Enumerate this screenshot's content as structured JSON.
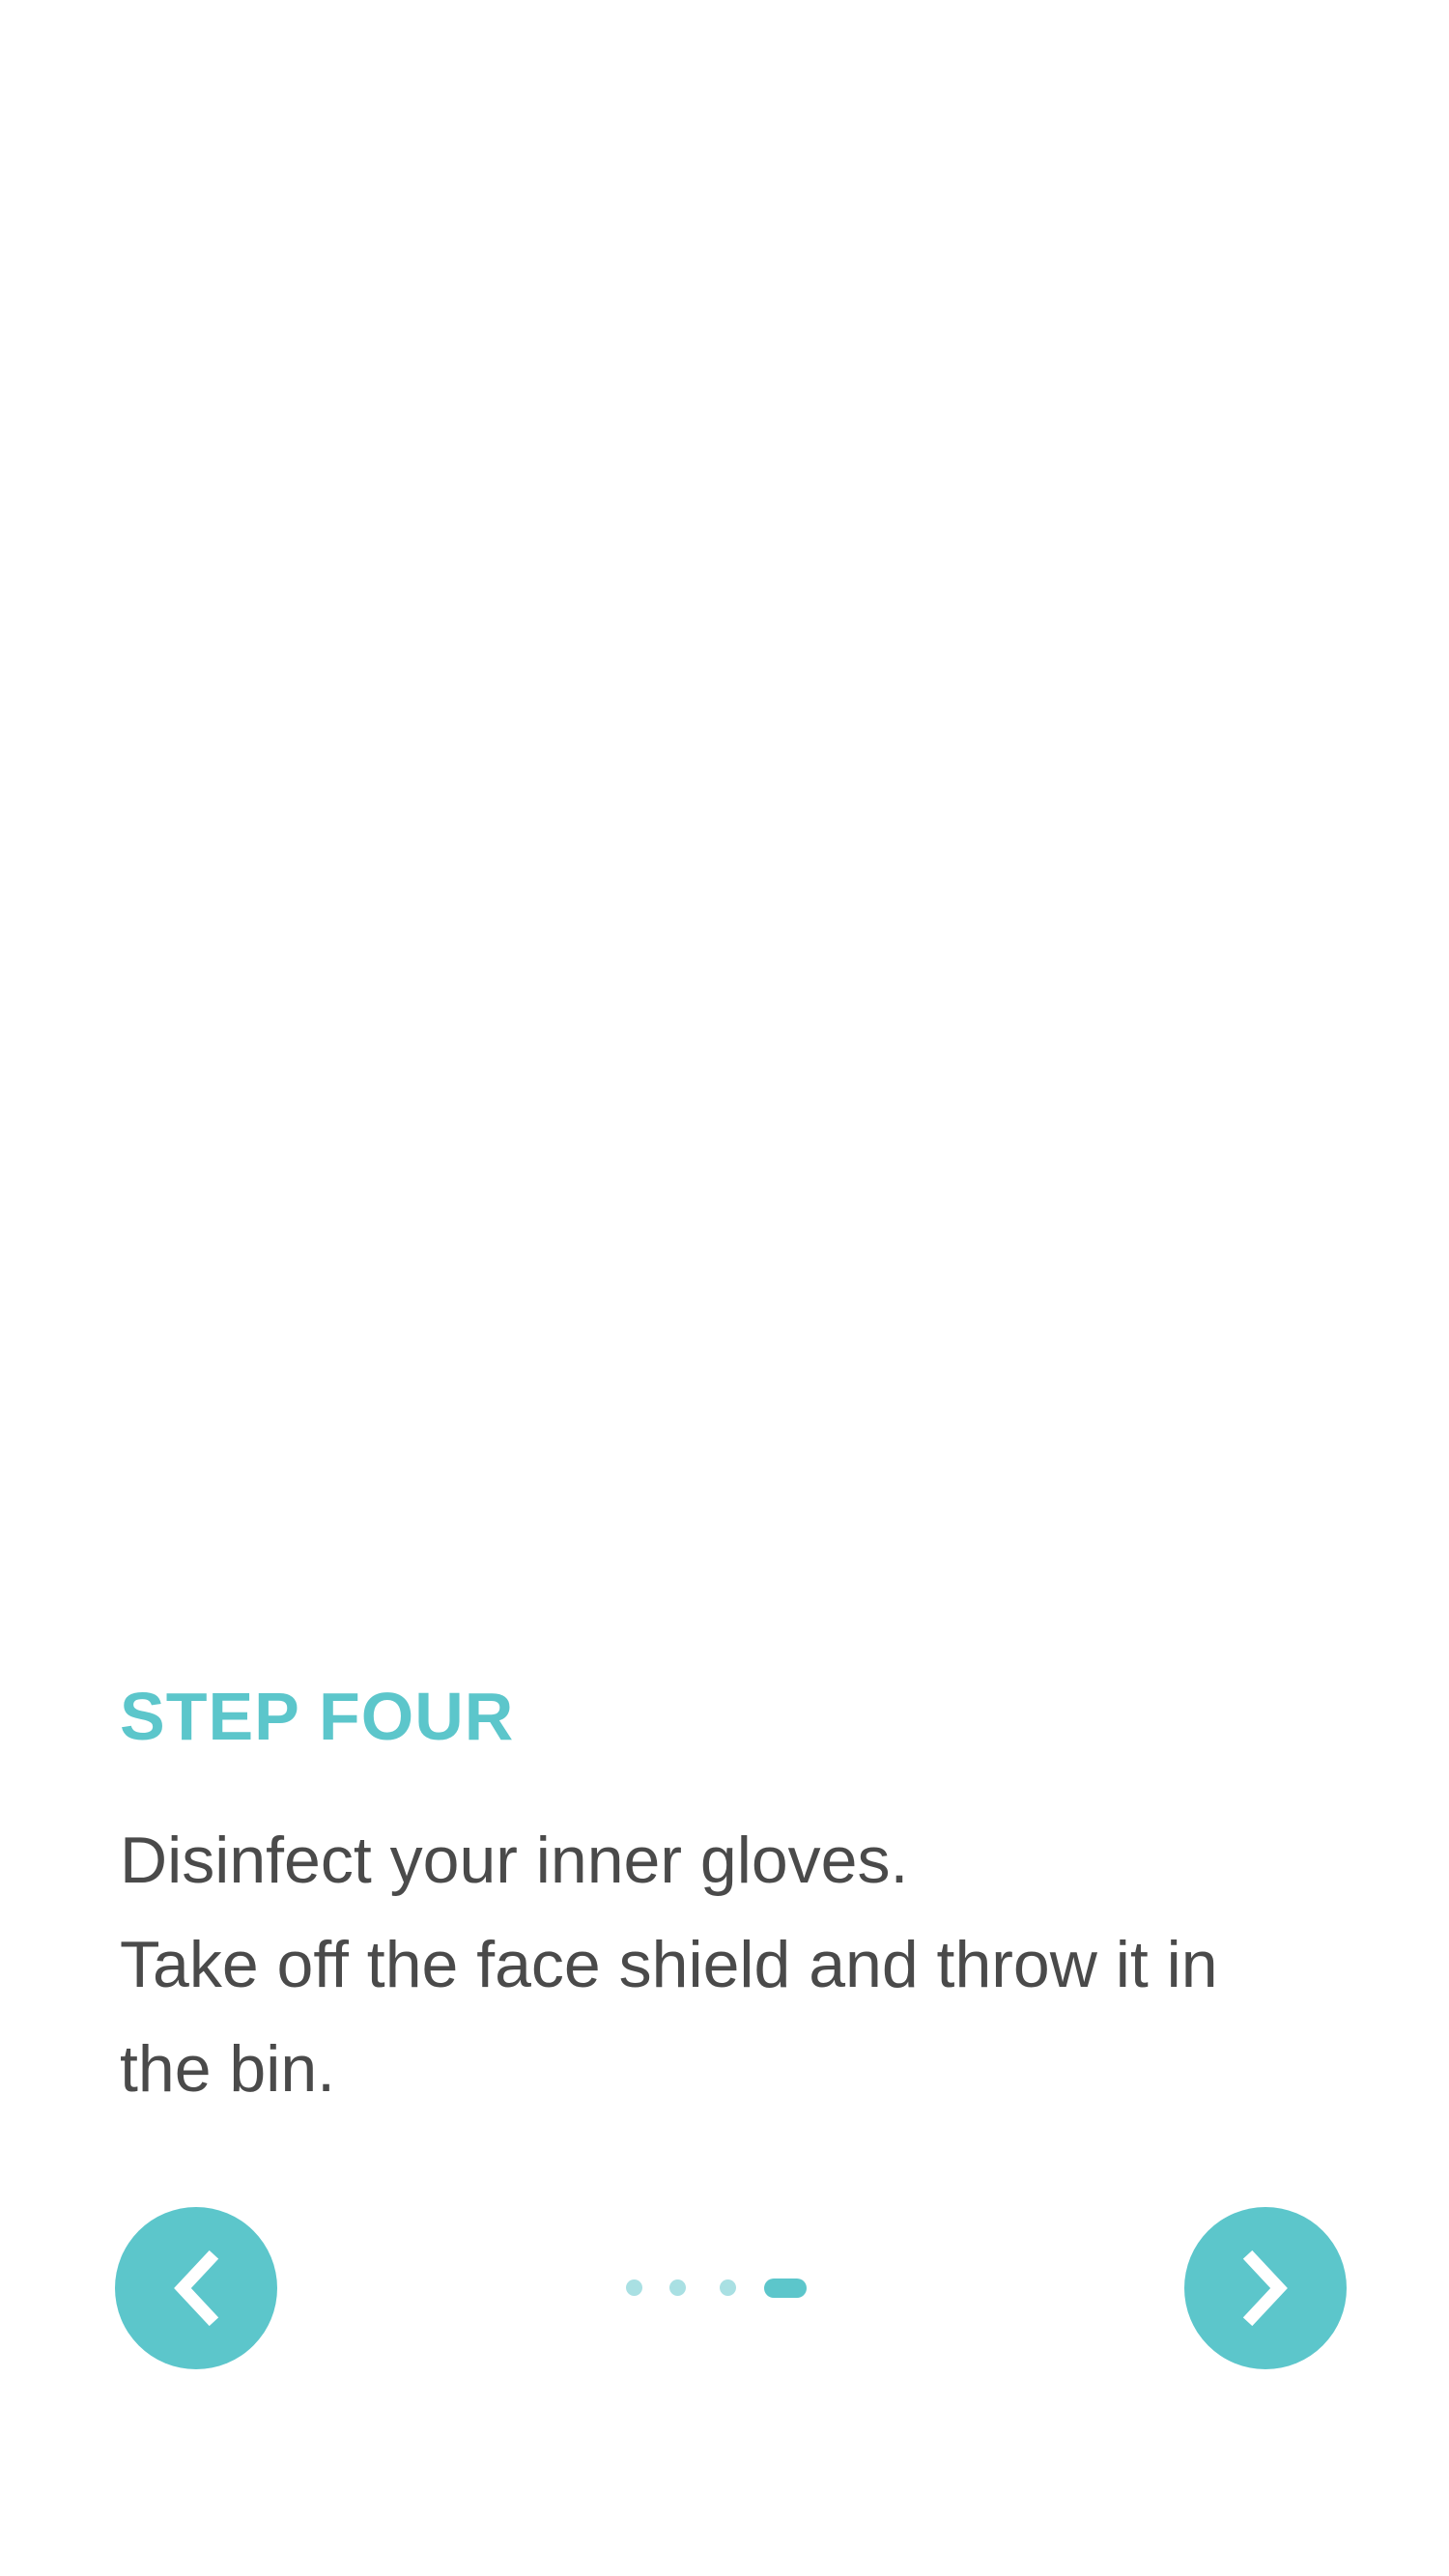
{
  "step": {
    "title": "STEP FOUR",
    "lines": [
      "Disinfect your inner gloves.",
      "Take off the face shield and throw it in",
      "the bin."
    ]
  },
  "navigation": {
    "prev_icon": "chevron-left-icon",
    "next_icon": "chevron-right-icon",
    "page_count": 4,
    "current_page": 4
  },
  "colors": {
    "accent": "#5cc6cb",
    "accent_light": "#a9e0e3",
    "body_text": "#4a4a4a",
    "background": "#ffffff"
  }
}
